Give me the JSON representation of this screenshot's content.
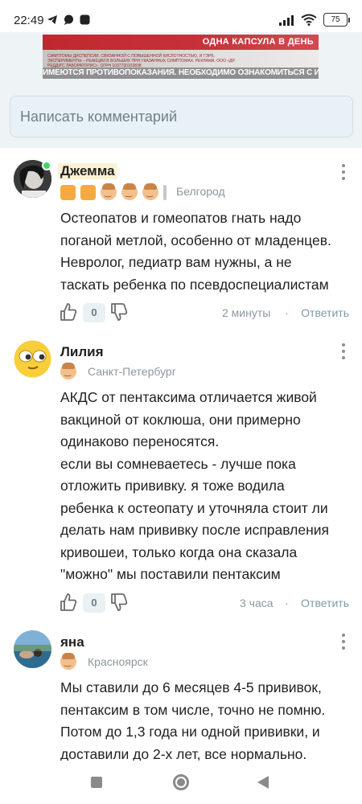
{
  "status_bar": {
    "time": "22:49",
    "battery": "75",
    "left_icons": [
      "telegram-icon",
      "chat-bubble-icon",
      "app-square-icon"
    ],
    "right_icons": [
      "signal-icon",
      "wifi-icon",
      "battery-icon"
    ]
  },
  "ad": {
    "headline": "ОДНА КАПСУЛА В ДЕНЬ",
    "small_text": "СИМПТОМЫ ДИСПЕПСИИ, СВЯЗАННОЙ С ПОВЫШЕННОЙ КИСЛОТНОСТЬЮ, И ГЭРБ. ЭКСПЕРИМЕНТЫ – РЕАКЦИИ В БОЛЬШИХ ПРИ УКАЗАННЫХ СИМПТОМАХ. РЕКЛАМА. ООО «ДР. РЕДДИ'С ЛАБОРАТОРИС». ОГРН 1037700103838.",
    "warning": "ИМЕЮТСЯ ПРОТИВОПОКАЗАНИЯ. НЕОБХОДИМО ОЗНАКОМИТЬСЯ С ИНСТРУКЦИЕЙ"
  },
  "comment_input": {
    "placeholder": "Написать комментарий"
  },
  "comments": [
    {
      "author": "Джемма",
      "city": "Белгород",
      "online": true,
      "lines": [
        "Остеопатов и гомеопатов гнать надо",
        "поганой метлой, особенно от младенцев.",
        "Невролог, педиатр вам нужны, а не",
        "таскать ребенка по псевдоспециалистам"
      ],
      "likes": "0",
      "time": "2 минуты",
      "reply": "Ответить"
    },
    {
      "author": "Лилия",
      "city": "Санкт-Петербург",
      "lines": [
        "АКДС от пентаксима отличается живой",
        "вакциной от коклюша, они примерно",
        "одинаково переносятся.",
        "если вы сомневаетесь - лучше пока",
        "отложить прививку. я тоже водила",
        "ребенка к остеопату и уточняла стоит ли",
        "делать нам прививку после исправления",
        "кривошеи, только когда она сказала",
        "\"можно\" мы поставили пентаксим"
      ],
      "likes": "0",
      "time": "3 часа",
      "reply": "Ответить"
    },
    {
      "author": "яна",
      "city": "Красноярск",
      "lines": [
        "Мы ставили до 6 месяцев 4-5 прививок,",
        "пентаксим в том числе, точно не помню.",
        "Потом до 1,3 года ни одной прививки, и",
        "доставили до 2-х лет, все нормально."
      ]
    }
  ],
  "nav_bar": {
    "icons": [
      "recent-apps-icon",
      "home-icon",
      "back-icon"
    ]
  }
}
